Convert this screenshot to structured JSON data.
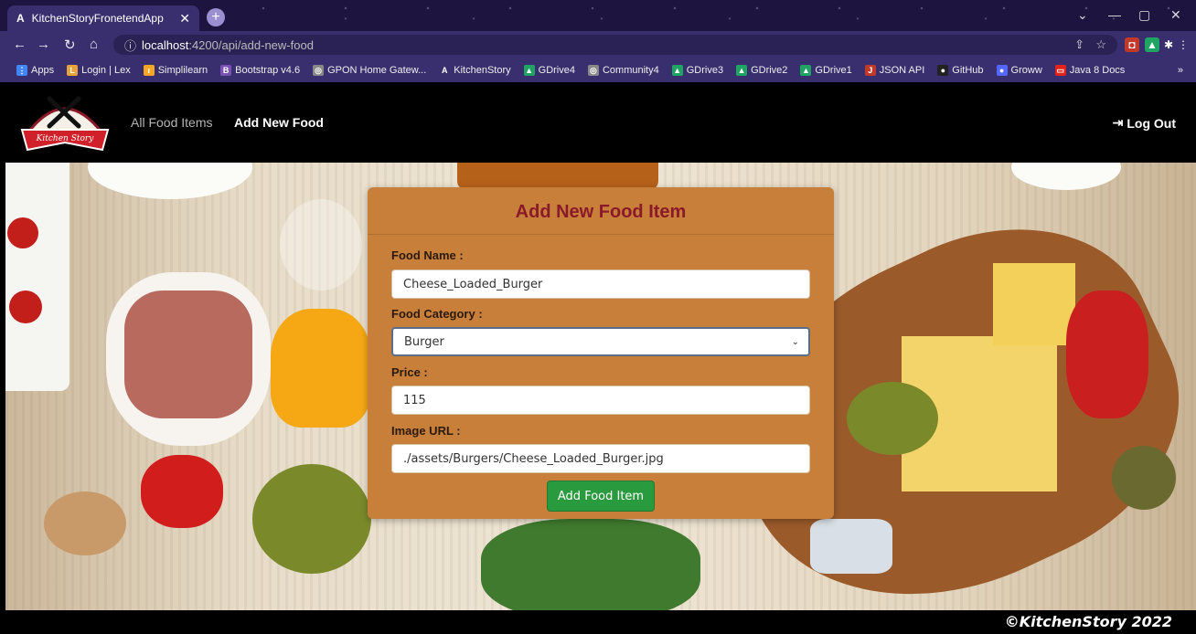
{
  "browser": {
    "tab_title": "KitchenStoryFronetendApp",
    "tab_favicon": "A",
    "url_host": "localhost",
    "url_path": ":4200/api/add-new-food",
    "bookmarks": [
      {
        "label": "Apps",
        "icon": "apps-grid-icon",
        "color": "#4285f4",
        "glyph": "⋮"
      },
      {
        "label": "Login | Lex",
        "icon": "lex-icon",
        "color": "#e8a33a",
        "glyph": "L"
      },
      {
        "label": "Simplilearn",
        "icon": "simplilearn-icon",
        "color": "#f5a623",
        "glyph": "ı"
      },
      {
        "label": "Bootstrap v4.6",
        "icon": "bootstrap-icon",
        "color": "#7952b3",
        "glyph": "B"
      },
      {
        "label": "GPON Home Gatew...",
        "icon": "globe-icon",
        "color": "#888888",
        "glyph": "◎"
      },
      {
        "label": "KitchenStory",
        "icon": "angular-icon",
        "color": "#3a2f6e",
        "glyph": "A"
      },
      {
        "label": "GDrive4",
        "icon": "gdrive-icon",
        "color": "#1fa463",
        "glyph": "▲"
      },
      {
        "label": "Community4",
        "icon": "globe-icon",
        "color": "#888888",
        "glyph": "◎"
      },
      {
        "label": "GDrive3",
        "icon": "gdrive-icon",
        "color": "#1fa463",
        "glyph": "▲"
      },
      {
        "label": "GDrive2",
        "icon": "gdrive-icon",
        "color": "#1fa463",
        "glyph": "▲"
      },
      {
        "label": "GDrive1",
        "icon": "gdrive-icon",
        "color": "#1fa463",
        "glyph": "▲"
      },
      {
        "label": "JSON API",
        "icon": "json-icon",
        "color": "#c0392b",
        "glyph": "J"
      },
      {
        "label": "GitHub",
        "icon": "github-icon",
        "color": "#222222",
        "glyph": "●"
      },
      {
        "label": "Groww",
        "icon": "groww-icon",
        "color": "#5367ff",
        "glyph": "●"
      },
      {
        "label": "Java 8 Docs",
        "icon": "oracle-icon",
        "color": "#e2231a",
        "glyph": "▭"
      }
    ]
  },
  "navbar": {
    "logo_text": "Kitchen Story",
    "links": {
      "all_food": "All Food Items",
      "add_food": "Add New Food"
    },
    "logout": "Log Out"
  },
  "form": {
    "title": "Add New Food Item",
    "food_name_label": "Food Name :",
    "food_name_value": "Cheese_Loaded_Burger",
    "category_label": "Food Category :",
    "category_value": "Burger",
    "price_label": "Price :",
    "price_value": "115",
    "image_label": "Image URL :",
    "image_value": "./assets/Burgers/Cheese_Loaded_Burger.jpg",
    "submit_label": "Add Food Item"
  },
  "footer": {
    "copyright": "©KitchenStory 2022"
  },
  "colors": {
    "card": "#c77f3a",
    "title": "#8a1a2a",
    "submit": "#2a9a3e"
  }
}
